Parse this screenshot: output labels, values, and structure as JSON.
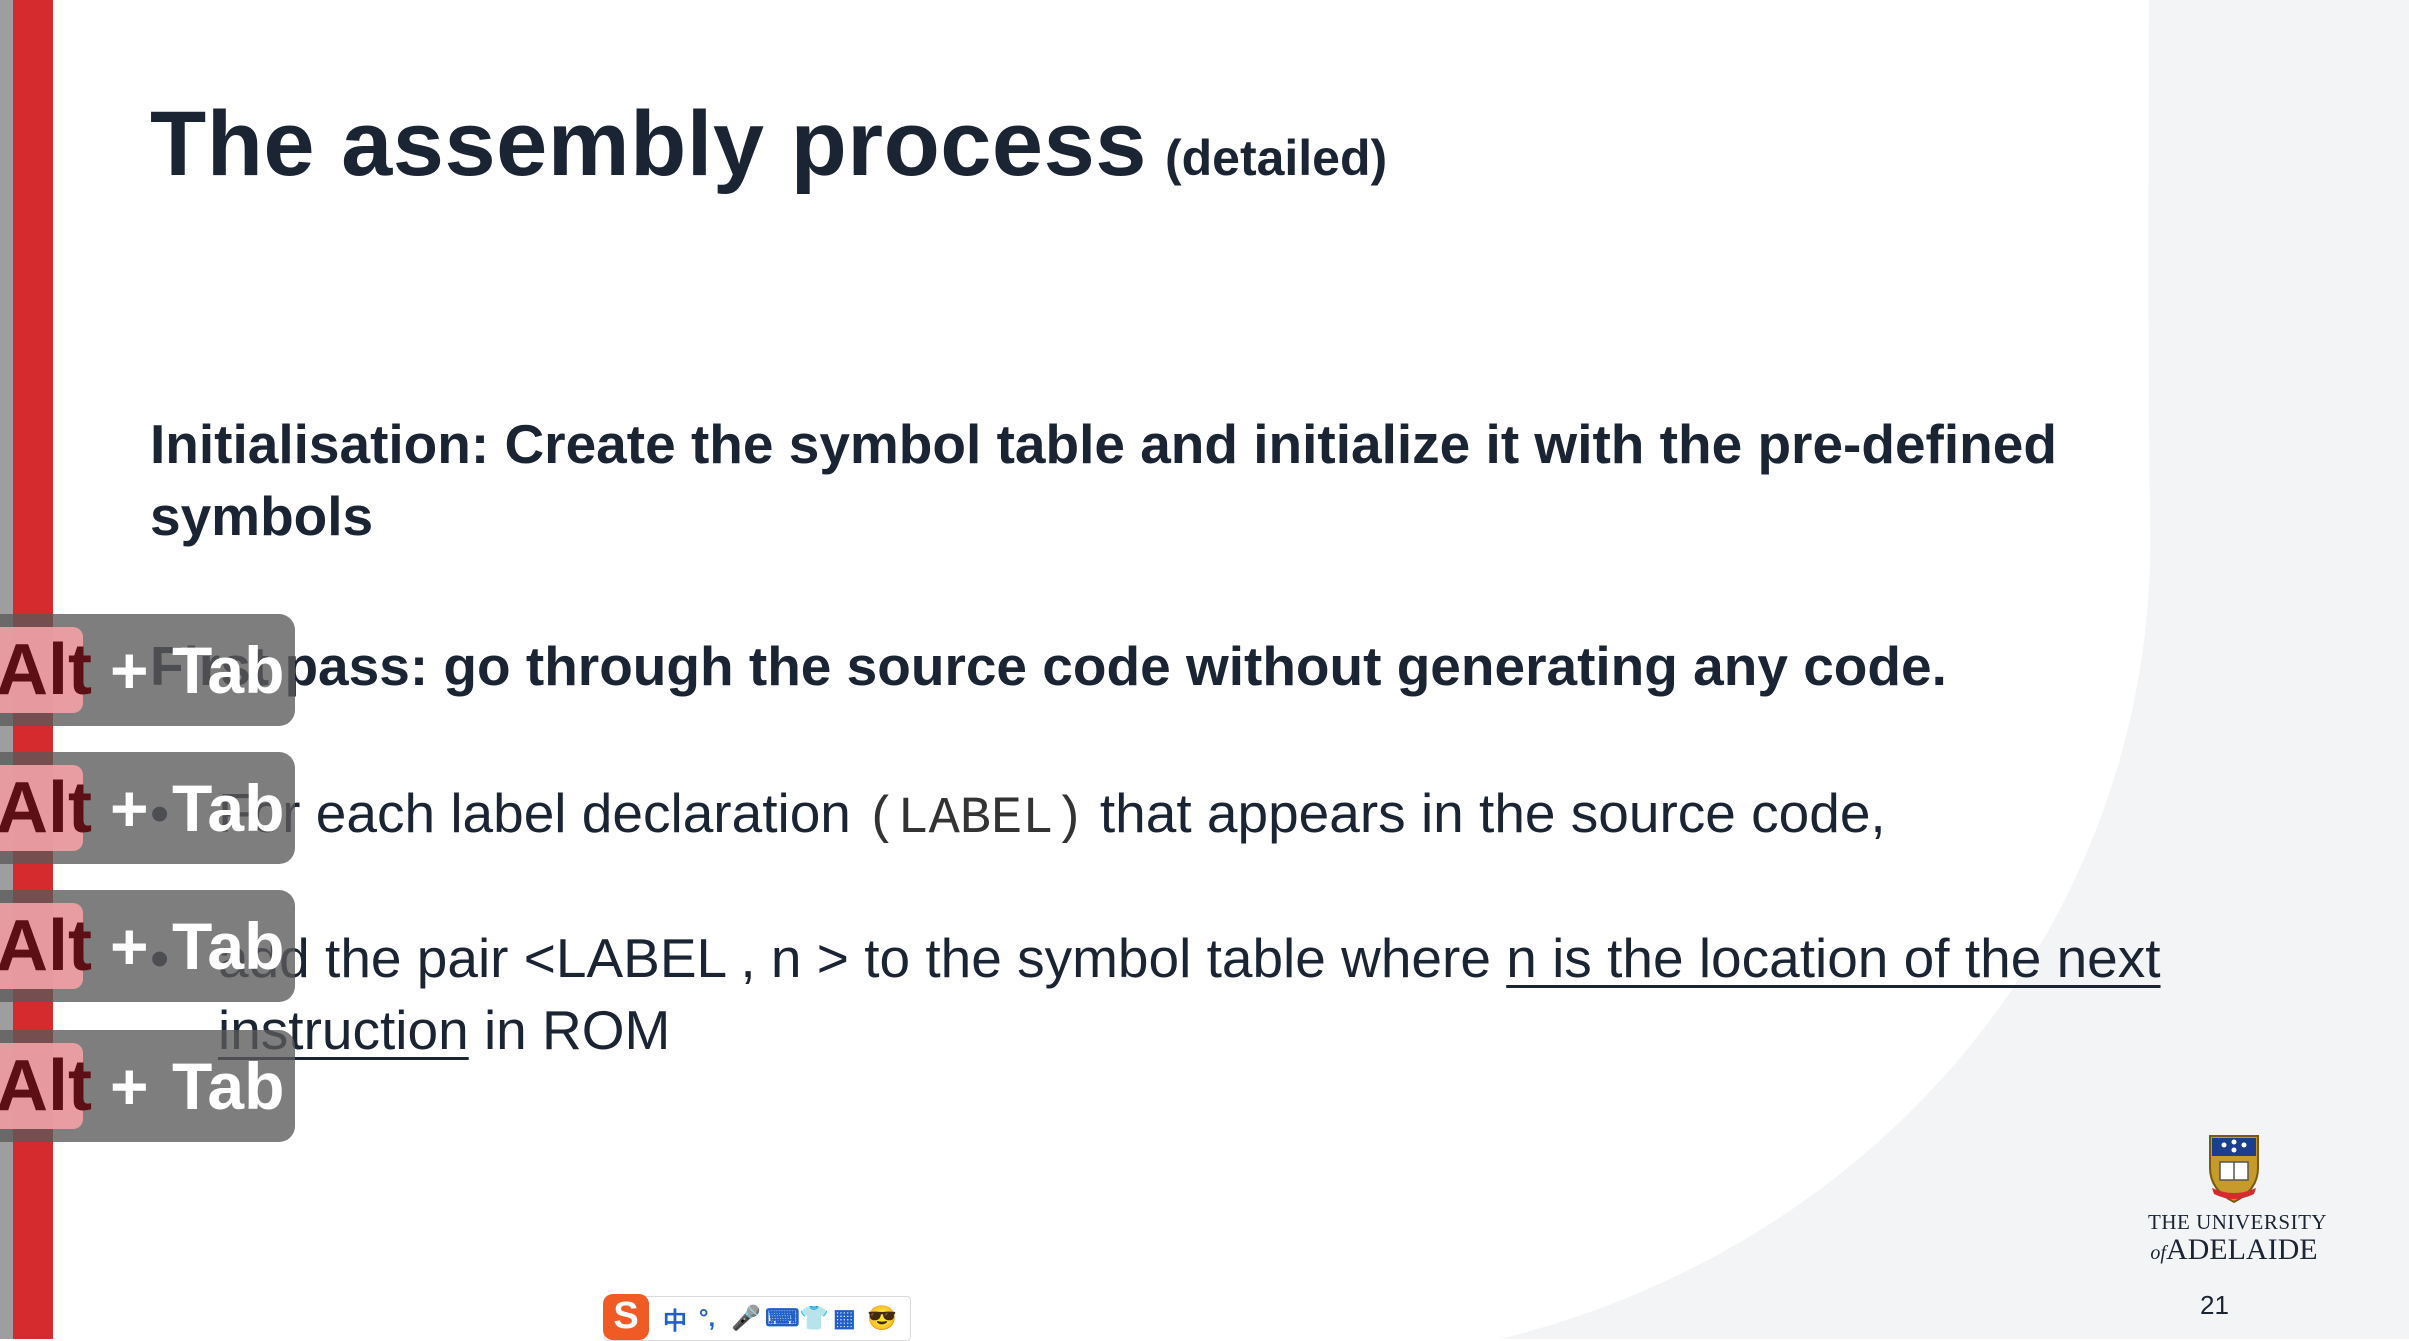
{
  "slide": {
    "title": "The assembly process",
    "title_suffix": "(detailed)",
    "initialisation": "Initialisation: Create the symbol table and initialize it with the pre-defined symbols",
    "first_pass": "First pass: go through the source code without generating any code.",
    "bullet1": {
      "marker": "•",
      "before": "For each label declaration",
      "code": "(LABEL)",
      "after": "that appears in the source code,"
    },
    "bullet2": {
      "marker": "•",
      "before": "add the pair <LABEL , n > to the symbol table where",
      "underlined_1": "n is the location of the next",
      "underlined_2": "instruction",
      "after": "in ROM"
    },
    "page_number": "21"
  },
  "logo": {
    "line1": "THE UNIVERSITY",
    "line2_prefix": "of",
    "line2": "ADELAIDE"
  },
  "alt_tab_overlays": [
    {
      "key": "Alt",
      "plus": "+",
      "tab": "Tab"
    },
    {
      "key": "Alt",
      "plus": "+",
      "tab": "Tab"
    },
    {
      "key": "Alt",
      "plus": "+",
      "tab": "Tab"
    },
    {
      "key": "Alt",
      "plus": "+",
      "tab": "Tab"
    }
  ],
  "ime_toolbar": {
    "logo": "S",
    "mode": "中",
    "items": [
      "°,",
      "🎤",
      "⌨",
      "👕",
      "▦",
      "😎"
    ]
  },
  "colors": {
    "accent_red": "#d52b2f",
    "text": "#1b2433",
    "ime_orange": "#f05a24"
  }
}
